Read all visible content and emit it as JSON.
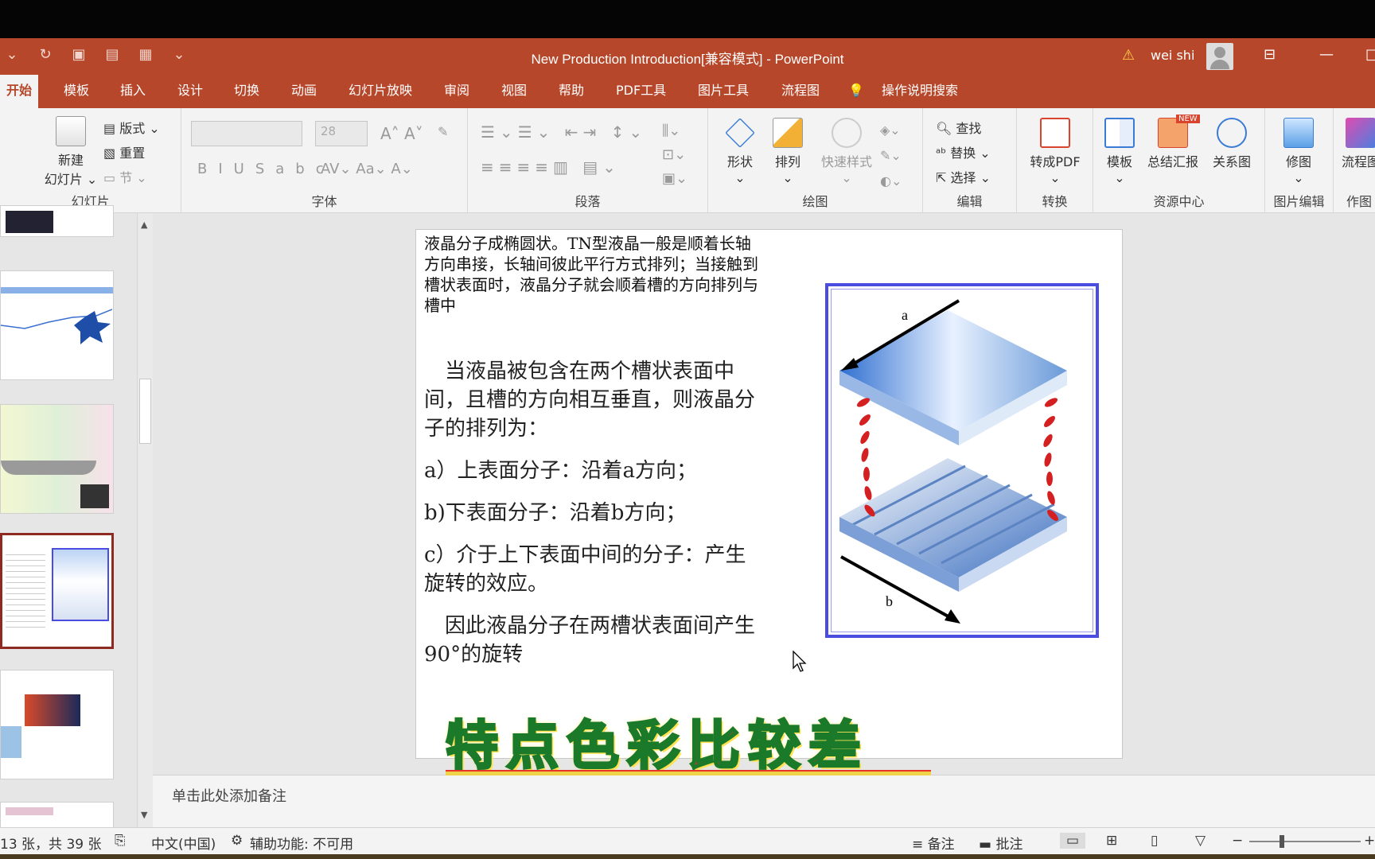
{
  "window": {
    "title": "New Production Introduction[兼容模式]  -  PowerPoint",
    "user": "wei shi"
  },
  "tabs": [
    "开始",
    "模板",
    "插入",
    "设计",
    "切换",
    "动画",
    "幻灯片放映",
    "审阅",
    "视图",
    "帮助",
    "PDF工具",
    "图片工具",
    "流程图",
    "操作说明搜索"
  ],
  "ribbon": {
    "slides": {
      "new_slide": "新建",
      "new_slide2": "幻灯片",
      "layout": "版式",
      "reset": "重置",
      "section": "节",
      "label": "幻灯片"
    },
    "font": {
      "size": "28",
      "label": "字体"
    },
    "paragraph": {
      "label": "段落"
    },
    "drawing": {
      "shape": "形状",
      "arrange": "排列",
      "quick_style": "快速样式",
      "label": "绘图"
    },
    "editing": {
      "find": "查找",
      "replace": "替换",
      "select": "选择",
      "label": "编辑"
    },
    "convert": {
      "to_pdf": "转成PDF",
      "label": "转换"
    },
    "resources": {
      "template": "模板",
      "report": "总结汇报",
      "relation": "关系图",
      "new_badge": "NEW",
      "label": "资源中心"
    },
    "image_edit": {
      "retouch": "修图",
      "label": "图片编辑"
    },
    "draw": {
      "flowchart": "流程图",
      "label": "作图"
    }
  },
  "slide": {
    "top_text": "液晶分子成椭圆状。TN型液晶一般是顺着长轴方向串接，长轴间彼此平行方式排列；当接触到槽状表面时，液晶分子就会顺着槽的方向排列与槽中",
    "body": [
      "　当液晶被包含在两个槽状表面中间，且槽的方向相互垂直，则液晶分子的排列为：",
      "a）上表面分子：沿着a方向；",
      "b)下表面分子：沿着b方向；",
      "c）介于上下表面中间的分子：产生旋转的效应。",
      "　因此液晶分子在两槽状表面间产生90°的旋转"
    ],
    "figure": {
      "label_a": "a",
      "label_b": "b"
    }
  },
  "notes_placeholder": "单击此处添加备注",
  "caption": "特点色彩比较差",
  "status": {
    "slide_count": "13 张，共 39 张",
    "language": "中文(中国)",
    "accessibility": "辅助功能: 不可用",
    "notes": "备注",
    "comments": "批注"
  }
}
